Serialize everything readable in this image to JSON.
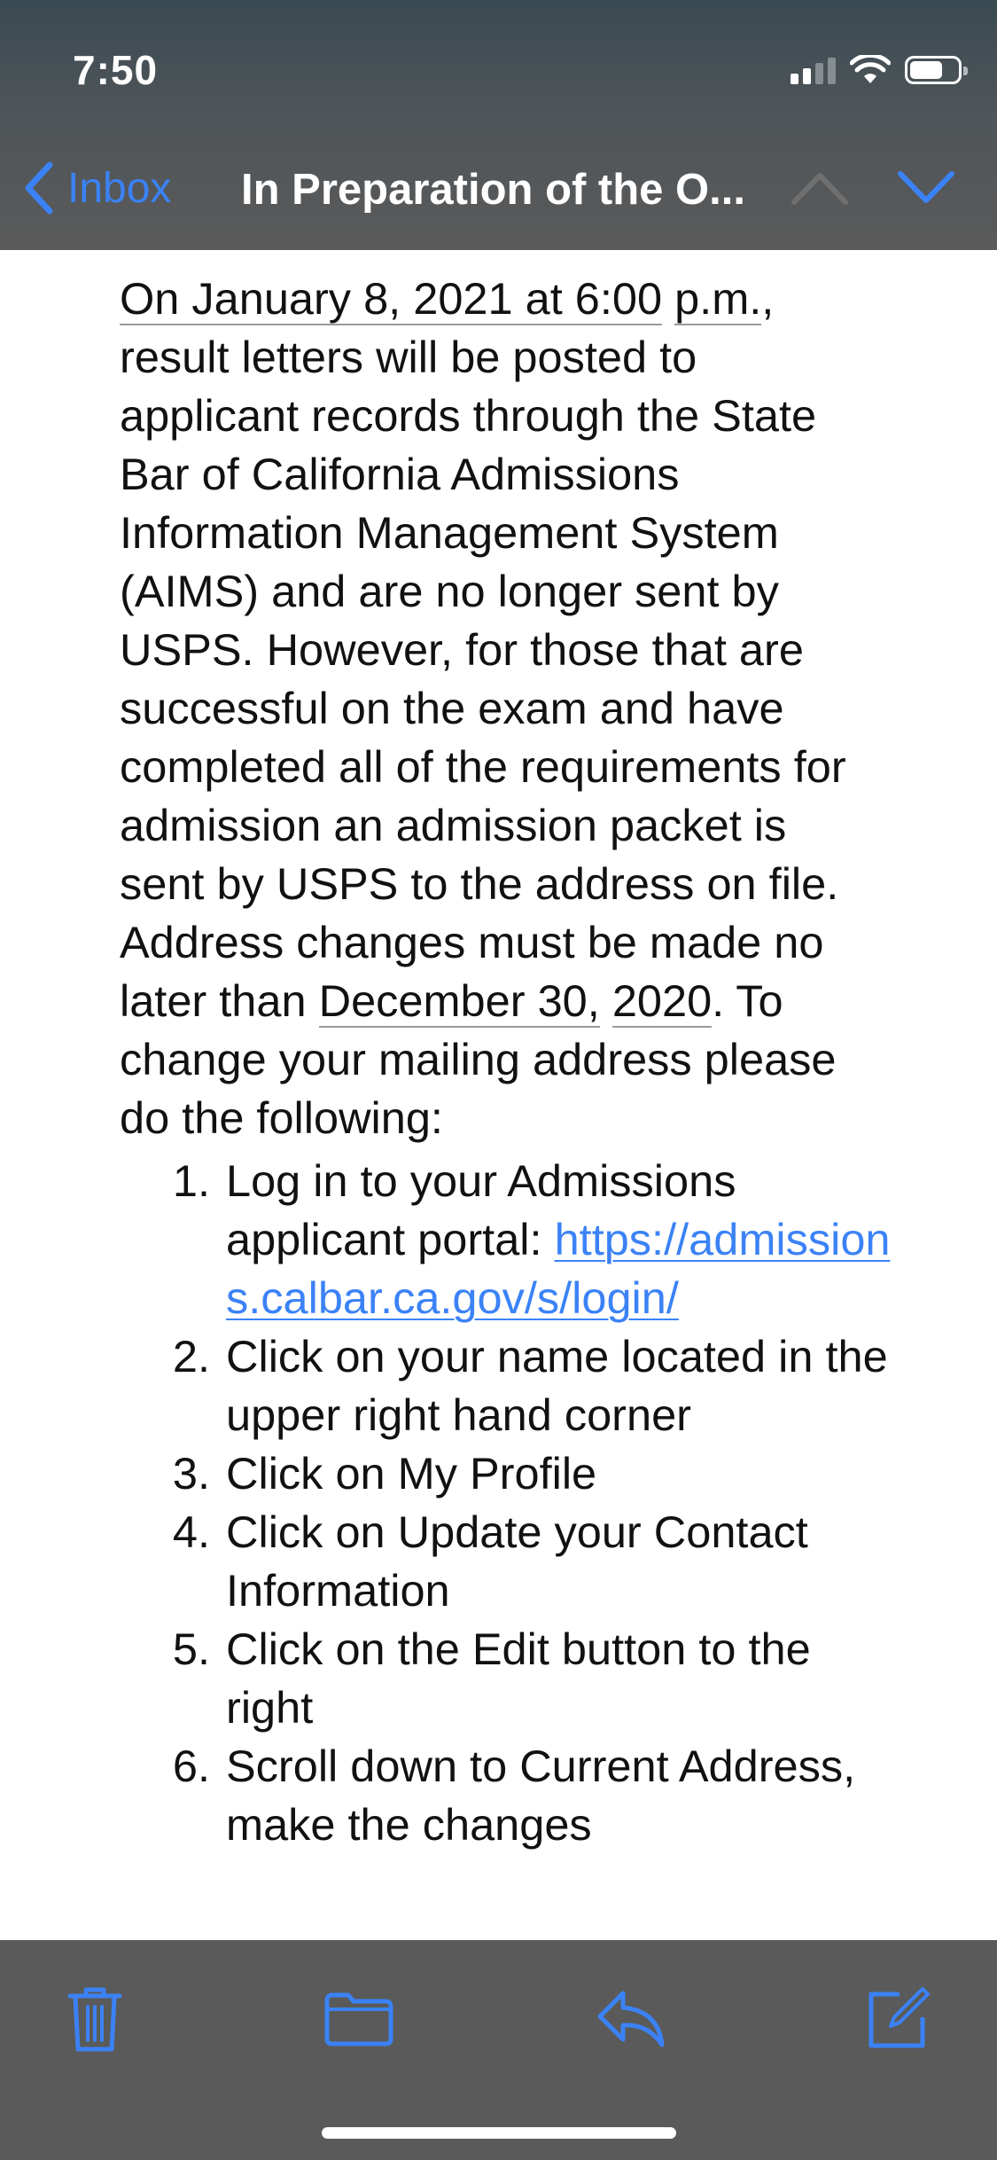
{
  "status_bar": {
    "time": "7:50",
    "signal_bars": 2,
    "battery_level": 0.7
  },
  "nav": {
    "back_label": "Inbox",
    "title": "In Preparation of the O...",
    "back_icon": "chevron-left-icon",
    "prev_icon": "chevron-up-icon",
    "next_icon": "chevron-down-icon"
  },
  "email": {
    "paragraph": {
      "date1_a": "On January 8, 2021 at 6:00",
      "date1_b": "p.m.",
      "text1": ", result letters will be posted to applicant records through the State Bar of California Admissions Information Management System (AIMS) and are no longer sent by USPS.  However, for those that are successful on the exam and have completed all of the requirements for admission an admission packet is sent by USPS to the address on file. Address changes must be made no later than ",
      "date2_a": "December 30,",
      "date2_b": "2020",
      "text2": ".  To change your mailing address please do the following:"
    },
    "steps": [
      {
        "num": "1.",
        "text": "Log in to your Admissions applicant portal: ",
        "link": "https://admissions.calbar.ca.gov/s/login/"
      },
      {
        "num": "2.",
        "text": "Click on your name located in the upper right hand corner"
      },
      {
        "num": "3.",
        "text": "Click on My Profile"
      },
      {
        "num": "4.",
        "text": "Click on Update your Contact Information"
      },
      {
        "num": "5.",
        "text": "Click on the Edit button to the right"
      },
      {
        "num": "6.",
        "text": "Scroll down to Current Address, make the changes"
      }
    ]
  },
  "toolbar": {
    "items": [
      "trash-icon",
      "folder-icon",
      "reply-icon",
      "compose-icon"
    ]
  },
  "colors": {
    "accent": "#3b82f6",
    "bar_background": "#5a5a5a"
  }
}
